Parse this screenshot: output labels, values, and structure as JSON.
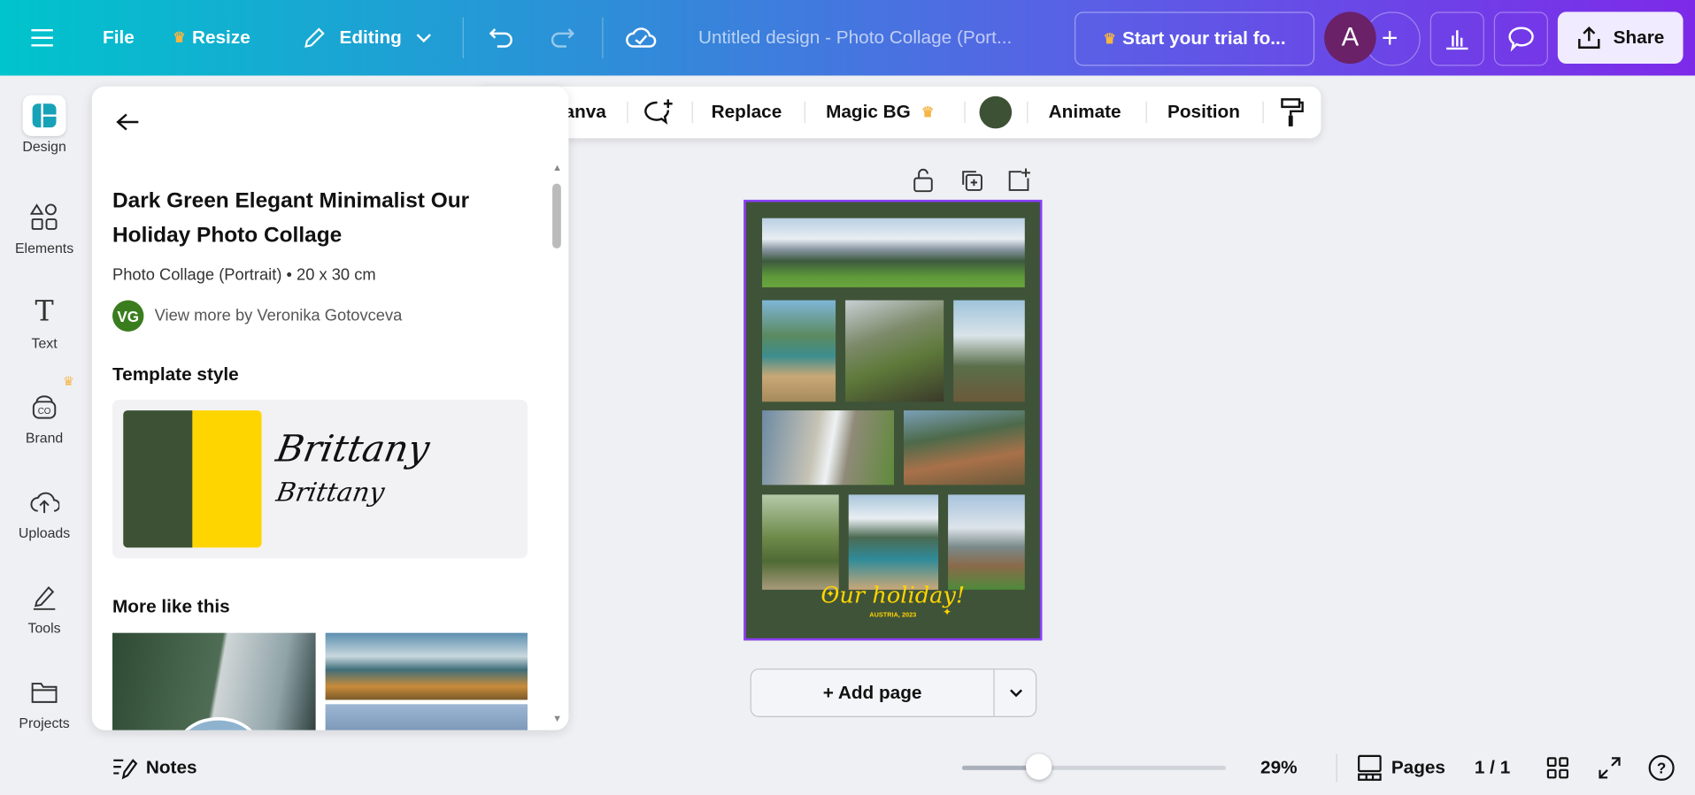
{
  "topbar": {
    "file": "File",
    "resize": "Resize",
    "editing": "Editing",
    "title": "Untitled design - Photo Collage (Port...",
    "trial": "Start your trial fo...",
    "avatar": "A",
    "share": "Share"
  },
  "rail": [
    {
      "label": "Design",
      "icon": "design-icon"
    },
    {
      "label": "Elements",
      "icon": "elements-icon"
    },
    {
      "label": "Text",
      "icon": "text-icon"
    },
    {
      "label": "Brand",
      "icon": "brand-icon"
    },
    {
      "label": "Uploads",
      "icon": "uploads-icon"
    },
    {
      "label": "Tools",
      "icon": "tools-icon"
    },
    {
      "label": "Projects",
      "icon": "projects-icon"
    }
  ],
  "panel": {
    "title": "Dark Green Elegant Minimalist Our Holiday Photo Collage",
    "meta": "Photo Collage (Portrait) • 20 x 30 cm",
    "author_initials": "VG",
    "author_link": "View more by Veronika Gotovceva",
    "style_heading": "Template style",
    "colors": [
      "#3d5235",
      "#ffd500"
    ],
    "font_sample_1": "Brittany",
    "font_sample_2": "Brittany",
    "more_heading": "More like this"
  },
  "context_toolbar": {
    "canva": "anva",
    "replace": "Replace",
    "magic_bg": "Magic BG",
    "color": "#3d5235",
    "animate": "Animate",
    "position": "Position"
  },
  "canvas": {
    "headline": "Our holiday!",
    "subline": "AUSTRIA, 2023",
    "add_page": "+ Add page"
  },
  "bottom": {
    "notes": "Notes",
    "zoom": "29%",
    "zoom_value": 29,
    "pages": "Pages",
    "page_count": "1 / 1"
  }
}
